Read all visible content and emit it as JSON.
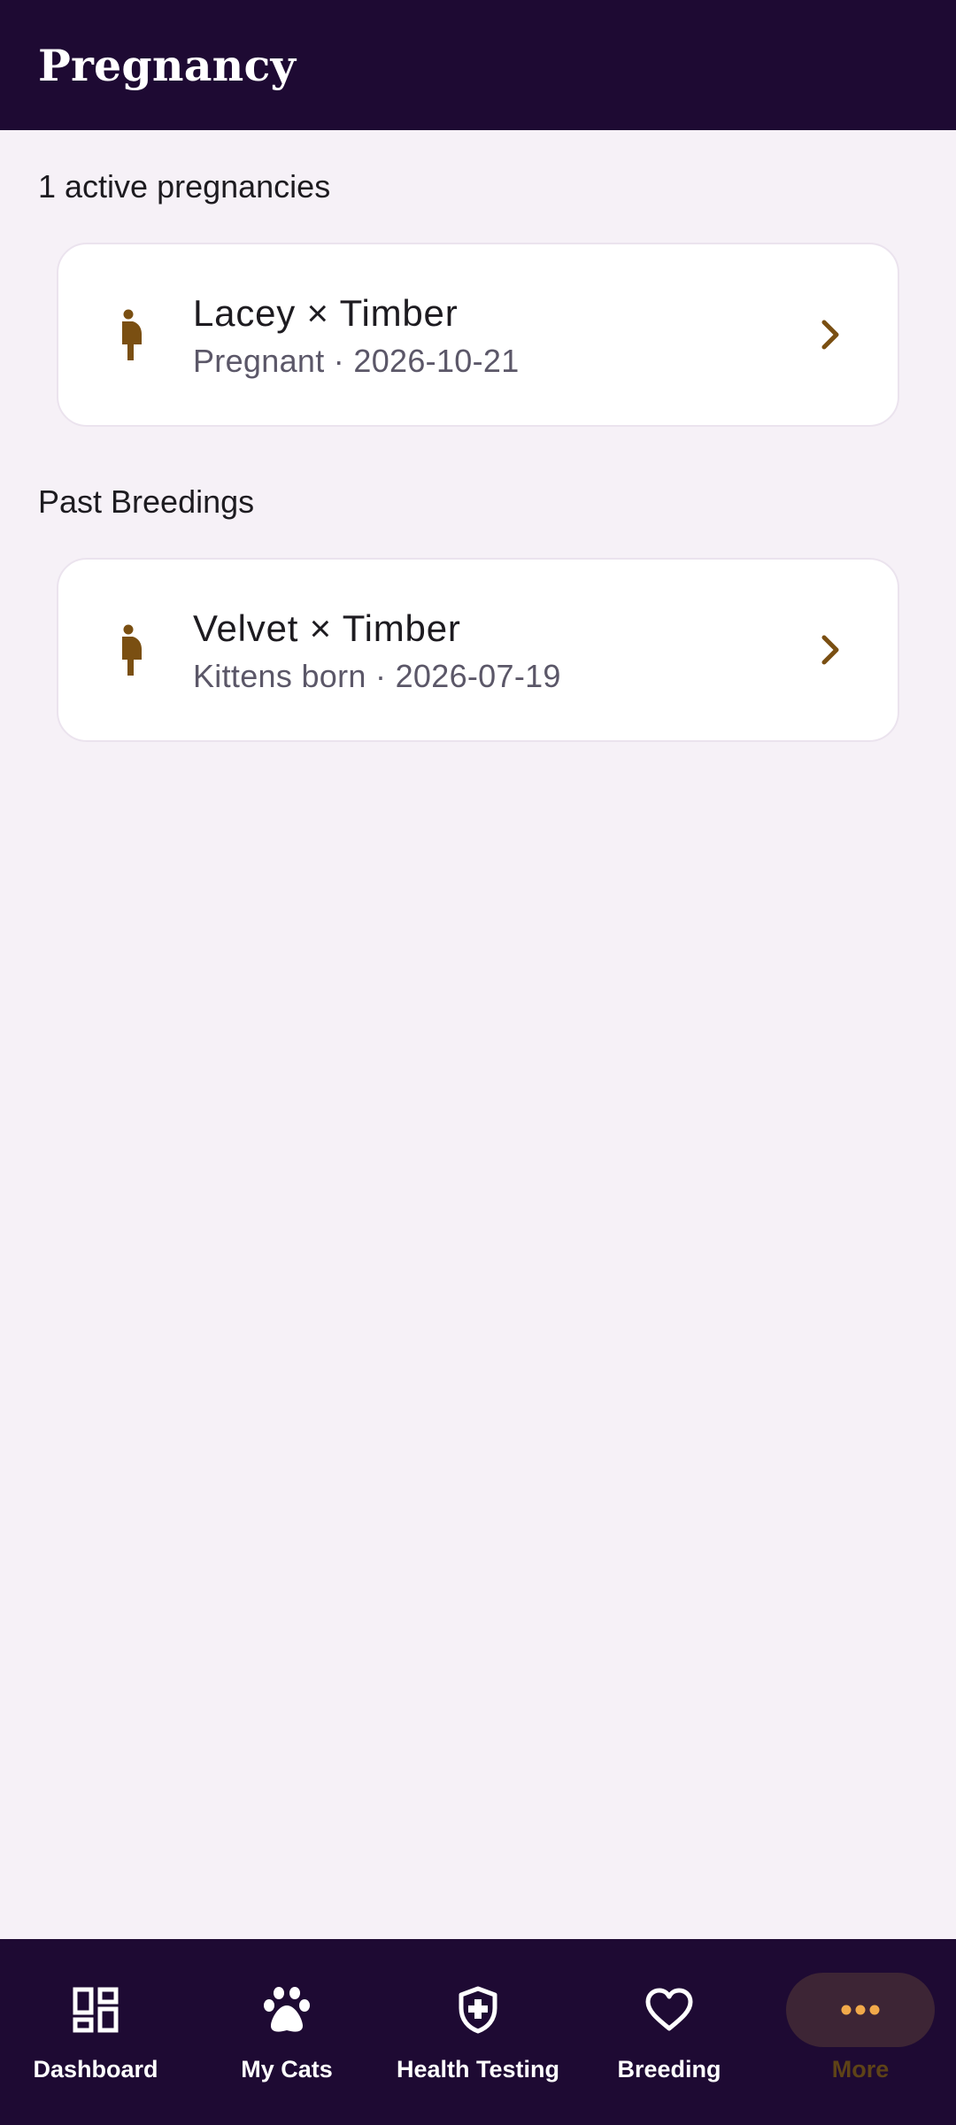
{
  "app_bar": {
    "title": "Pregnancy"
  },
  "active": {
    "summary": "1 active pregnancies",
    "items": [
      {
        "title": "Lacey × Timber",
        "subtitle": "Pregnant · 2026-10-21",
        "icon": "pregnant-woman-icon"
      }
    ]
  },
  "past": {
    "label": "Past Breedings",
    "items": [
      {
        "title": "Velvet × Timber",
        "subtitle": "Kittens born · 2026-07-19",
        "icon": "pregnant-woman-icon"
      }
    ]
  },
  "bottom_nav": {
    "items": [
      {
        "label": "Dashboard",
        "icon": "dashboard-icon"
      },
      {
        "label": "My Cats",
        "icon": "paw-icon"
      },
      {
        "label": "Health Testing",
        "icon": "shield-plus-icon"
      },
      {
        "label": "Breeding",
        "icon": "heart-icon"
      },
      {
        "label": "More",
        "icon": "more-horizontal-icon",
        "selected": true
      }
    ]
  },
  "colors": {
    "primary_dark": "#1e0a33",
    "accent_brown": "#7a4f12",
    "background": "#f6f1f7",
    "active_pill": "#3d2535",
    "more_dots": "#f1a94a"
  }
}
